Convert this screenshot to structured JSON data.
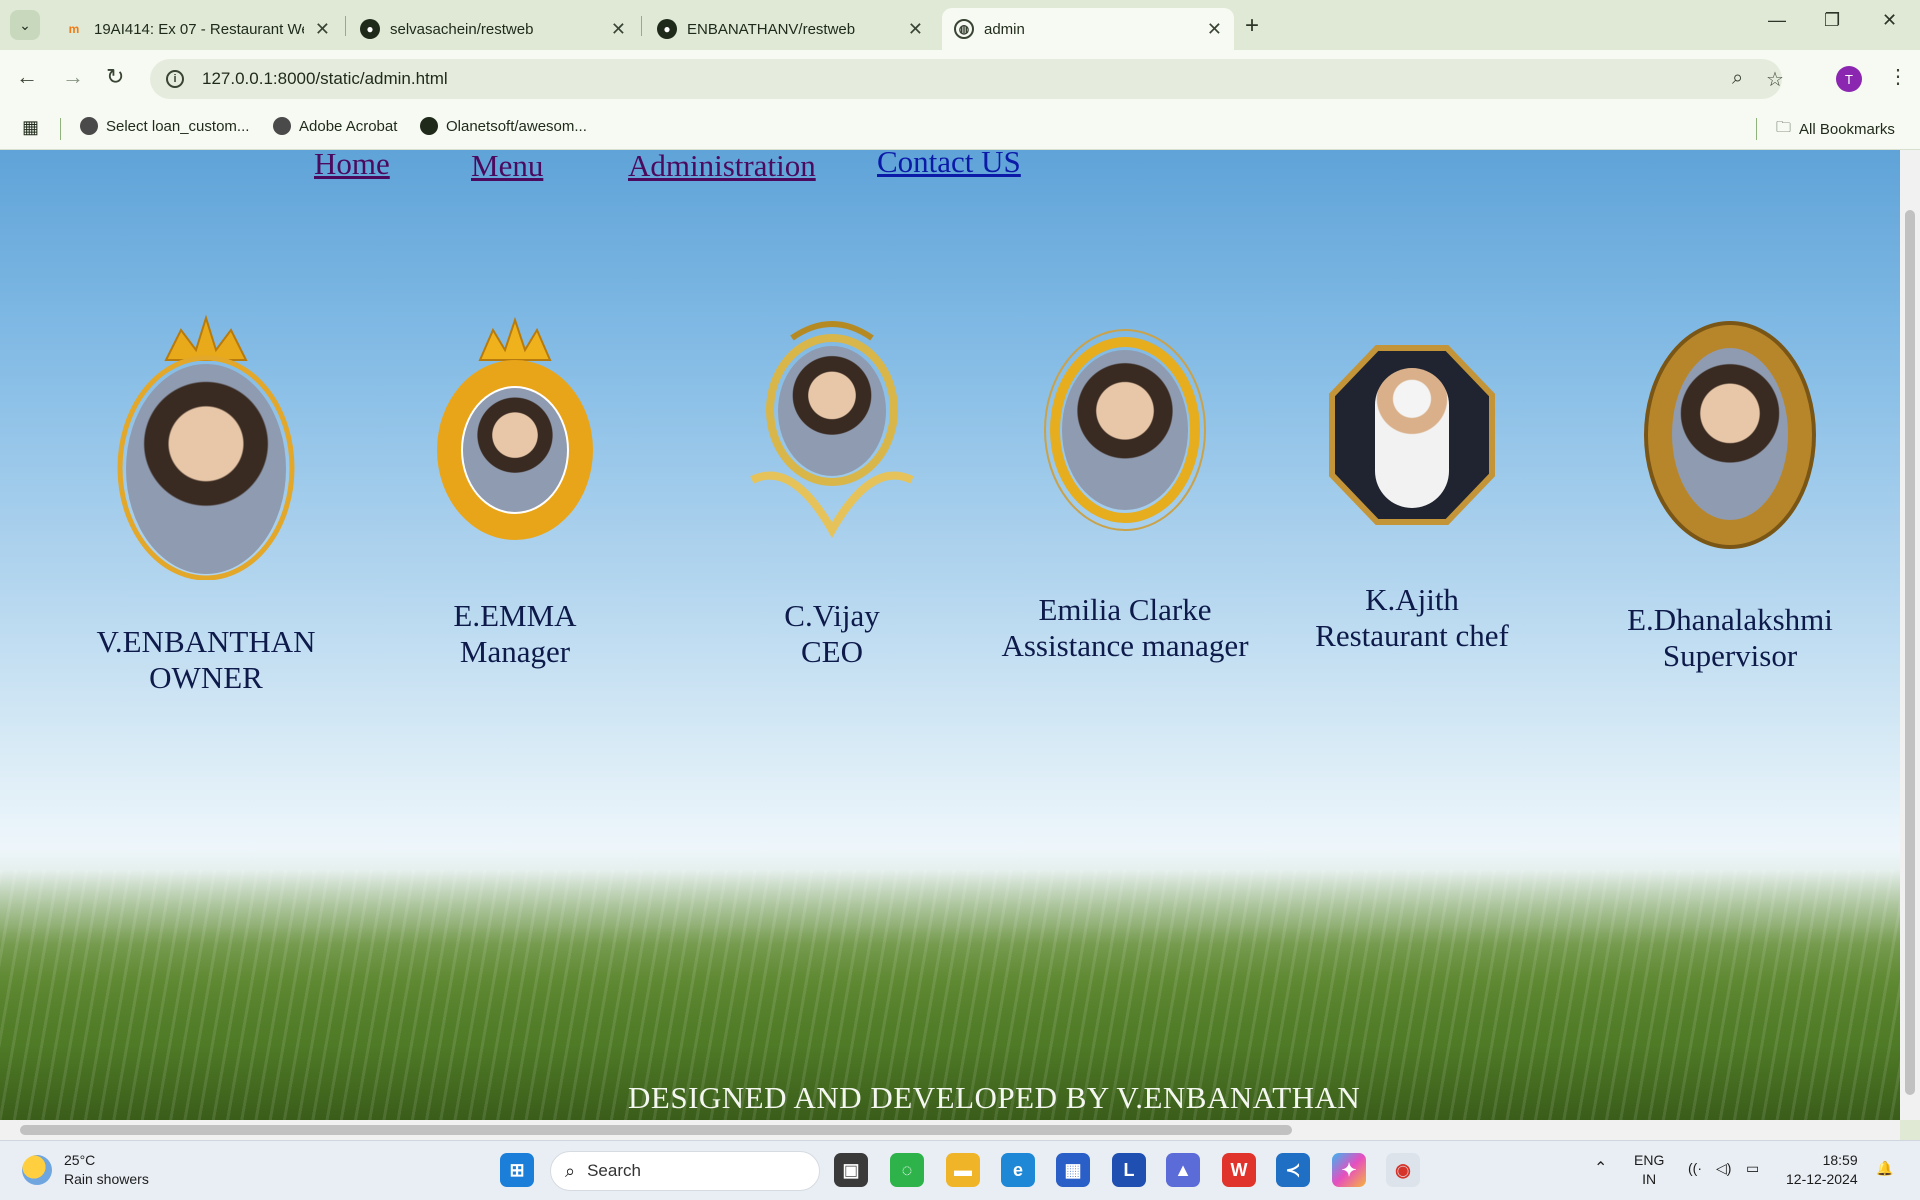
{
  "browser": {
    "tabs": [
      {
        "title": "19AI414: Ex 07 - Restaurant We",
        "favicon": "moodle-icon",
        "active": false
      },
      {
        "title": "selvasachein/restweb",
        "favicon": "github-icon",
        "active": false
      },
      {
        "title": "ENBANATHANV/restweb",
        "favicon": "github-icon",
        "active": false
      },
      {
        "title": "admin",
        "favicon": "globe-icon",
        "active": true
      }
    ],
    "url": "127.0.0.1:8000/static/admin.html",
    "profile_initial": "T",
    "bookmarks": [
      {
        "label": "Select loan_custom..."
      },
      {
        "label": "Adobe Acrobat"
      },
      {
        "label": "Olanetsoft/awesom..."
      }
    ],
    "all_bookmarks_label": "All Bookmarks"
  },
  "page": {
    "nav": [
      {
        "label": "Home",
        "state": "visited"
      },
      {
        "label": "Menu",
        "state": "visited"
      },
      {
        "label": "Administration",
        "state": "visited"
      },
      {
        "label": "Contact US",
        "state": "link"
      }
    ],
    "team": [
      {
        "name": "V.ENBANTHAN",
        "role": "OWNER",
        "frame": "gold-crown-oval"
      },
      {
        "name": "E.EMMA",
        "role": "Manager",
        "frame": "gold-laurel-crown"
      },
      {
        "name": "C.Vijay",
        "role": "CEO",
        "frame": "ornate-gold-baroque"
      },
      {
        "name": "Emilia Clarke",
        "role": "Assistance manager",
        "frame": "gold-oval-filigree"
      },
      {
        "name": "K.Ajith",
        "role": "Restaurant chef",
        "frame": "black-octagon-gold"
      },
      {
        "name": "E.Dhanalakshmi",
        "role": "Supervisor",
        "frame": "gold-leaf-oval"
      }
    ],
    "footer": "DESIGNED AND DEVELOPED BY V.ENBANATHAN",
    "colors": {
      "visited_link": "#4b0a5e",
      "link": "#0c1aa8",
      "text": "#0d1a4a"
    }
  },
  "taskbar": {
    "weather_temp": "25°C",
    "weather_desc": "Rain showers",
    "search_label": "Search",
    "lang_top": "ENG",
    "lang_bottom": "IN",
    "time": "18:59",
    "date": "12-12-2024"
  }
}
